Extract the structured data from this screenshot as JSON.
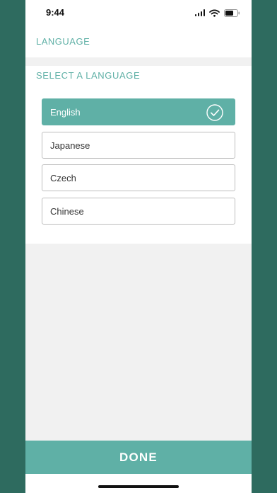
{
  "status_bar": {
    "time": "9:44",
    "icons": [
      "signal-icon",
      "wifi-icon",
      "battery-icon"
    ]
  },
  "header": {
    "title": "LANGUAGE"
  },
  "section": {
    "title": "SELECT A LANGUAGE"
  },
  "languages": [
    {
      "label": "English",
      "selected": true
    },
    {
      "label": "Japanese",
      "selected": false
    },
    {
      "label": "Czech",
      "selected": false
    },
    {
      "label": "Chinese",
      "selected": false
    }
  ],
  "done_button": {
    "label": "DONE"
  },
  "colors": {
    "accent": "#5fb0a6",
    "backdrop": "#2e6b5f",
    "surface": "#ffffff",
    "background": "#f1f1f1"
  }
}
